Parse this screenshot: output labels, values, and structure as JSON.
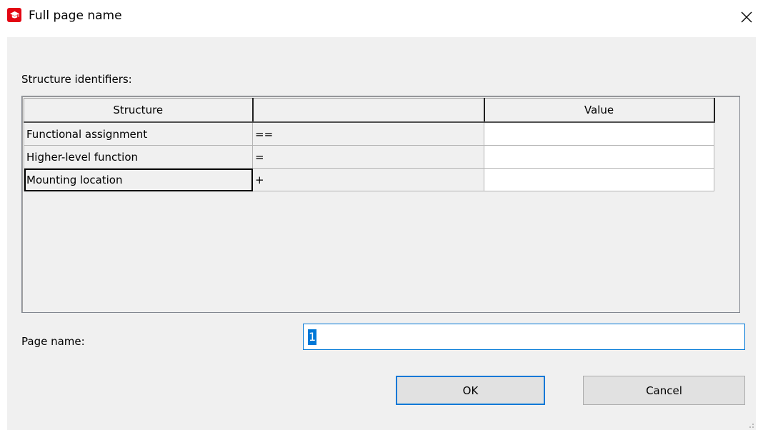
{
  "window": {
    "title": "Full page name",
    "app_icon": "eplan-icon",
    "close_icon": "close-icon",
    "accent": "#e30613"
  },
  "structure": {
    "label": "Structure identifiers:",
    "columns": [
      "Structure",
      "",
      "Value"
    ],
    "rows": [
      {
        "name": "Functional assignment",
        "symbol": "==",
        "value": ""
      },
      {
        "name": "Higher-level function",
        "symbol": "=",
        "value": ""
      },
      {
        "name": "Mounting location",
        "symbol": "+",
        "value": ""
      }
    ]
  },
  "page_name": {
    "label": "Page name:",
    "value": "1"
  },
  "buttons": {
    "ok": "OK",
    "cancel": "Cancel"
  },
  "colors": {
    "focus": "#0078d7",
    "dialog_bg": "#f0f0f0"
  }
}
